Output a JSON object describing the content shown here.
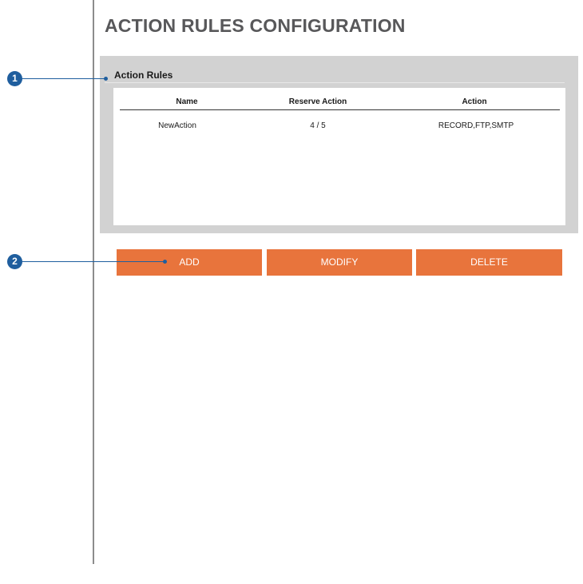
{
  "page": {
    "title": "ACTION RULES CONFIGURATION"
  },
  "action_rules": {
    "label": "Action Rules",
    "columns": [
      "Name",
      "Reserve Action",
      "Action"
    ],
    "rows": [
      {
        "name": "NewAction",
        "reserve_action": "4 / 5",
        "action": "RECORD,FTP,SMTP"
      }
    ]
  },
  "buttons": {
    "add": "ADD",
    "modify": "MODIFY",
    "delete": "DELETE"
  },
  "callouts": {
    "one": "1",
    "two": "2"
  },
  "colors": {
    "accent_button": "#e8743c",
    "callout": "#1f5e9e",
    "panel": "#d2d2d2",
    "title": "#58585a"
  }
}
